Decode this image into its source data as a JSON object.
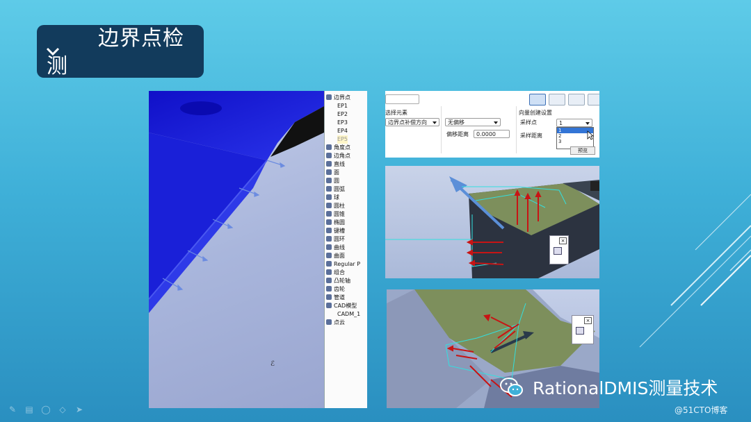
{
  "slide": {
    "title_line1": "边界点检",
    "title_line2": "测"
  },
  "tree": {
    "items": [
      {
        "label": "边界点",
        "sub": false,
        "hl": false
      },
      {
        "label": "EP1",
        "sub": true,
        "hl": false
      },
      {
        "label": "EP2",
        "sub": true,
        "hl": false
      },
      {
        "label": "EP3",
        "sub": true,
        "hl": false
      },
      {
        "label": "EP4",
        "sub": true,
        "hl": false
      },
      {
        "label": "EP5",
        "sub": true,
        "hl": true
      },
      {
        "label": "角度点",
        "sub": false,
        "hl": false
      },
      {
        "label": "边角点",
        "sub": false,
        "hl": false
      },
      {
        "label": "直线",
        "sub": false,
        "hl": false
      },
      {
        "label": "面",
        "sub": false,
        "hl": false
      },
      {
        "label": "圆",
        "sub": false,
        "hl": false
      },
      {
        "label": "圆弧",
        "sub": false,
        "hl": false
      },
      {
        "label": "球",
        "sub": false,
        "hl": false
      },
      {
        "label": "圆柱",
        "sub": false,
        "hl": false
      },
      {
        "label": "圆锥",
        "sub": false,
        "hl": false
      },
      {
        "label": "椭圆",
        "sub": false,
        "hl": false
      },
      {
        "label": "键槽",
        "sub": false,
        "hl": false
      },
      {
        "label": "圆环",
        "sub": false,
        "hl": false
      },
      {
        "label": "曲线",
        "sub": false,
        "hl": false
      },
      {
        "label": "曲面",
        "sub": false,
        "hl": false
      },
      {
        "label": "Regular P",
        "sub": false,
        "hl": false
      },
      {
        "label": "组合",
        "sub": false,
        "hl": false
      },
      {
        "label": "凸轮轴",
        "sub": false,
        "hl": false
      },
      {
        "label": "齿轮",
        "sub": false,
        "hl": false
      },
      {
        "label": "管道",
        "sub": false,
        "hl": false
      },
      {
        "label": "CAD模型",
        "sub": false,
        "hl": false
      },
      {
        "label": "CADM_1",
        "sub": true,
        "hl": false
      },
      {
        "label": "点云",
        "sub": false,
        "hl": false
      }
    ]
  },
  "dialog": {
    "select_element_label": "选择元素",
    "select_element_value": "边界点补偿方向",
    "offset_value": "无偏移",
    "offset_distance_label": "偏移距离",
    "offset_distance_value": "0.0000",
    "vector_settings_label": "向量创建设置",
    "sample_points_label": "采样点",
    "sample_points_value": "1",
    "sample_distance_label": "采样距离",
    "dropdown_options": [
      "1",
      "2",
      "3"
    ],
    "hidden_button_label": "预览"
  },
  "watermark": {
    "brand_text": "RationalDMIS测量技术",
    "blog_text": "@51CTO博客"
  },
  "colors": {
    "background": "#3fb0d8",
    "title_box": "#123b5c",
    "part_blue": "#1a20d8",
    "arrow_red": "#c81414",
    "green_face": "#7d8f5c"
  }
}
